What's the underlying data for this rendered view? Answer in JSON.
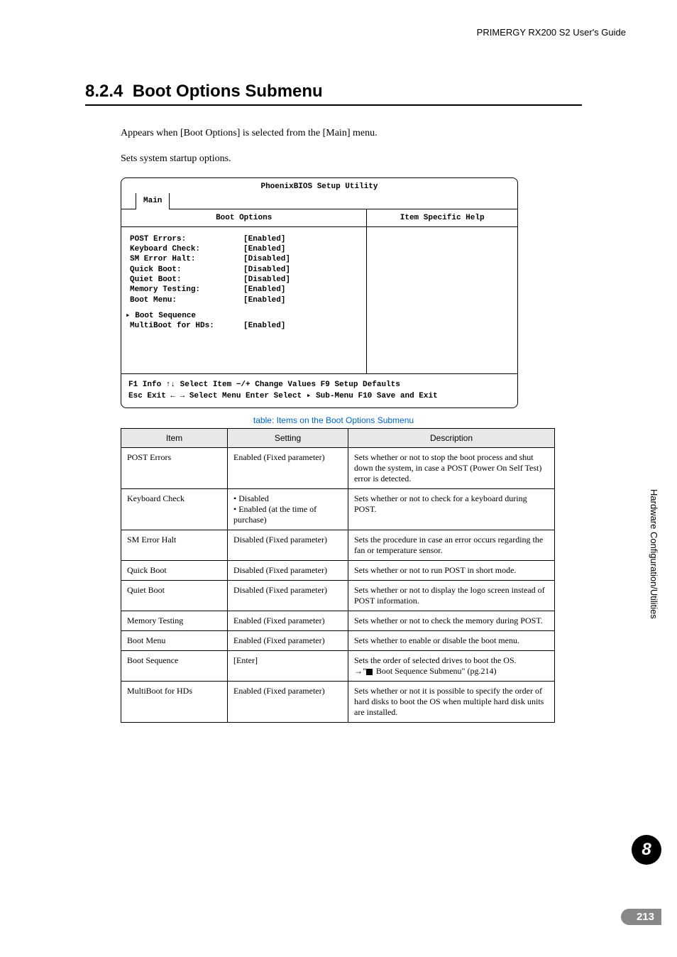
{
  "header": {
    "doc": "PRIMERGY RX200 S2 User's Guide"
  },
  "section": {
    "number": "8.2.4",
    "title": "Boot Options Submenu",
    "intro1": "Appears when [Boot Options] is selected from the [Main] menu.",
    "intro2": "Sets system startup options."
  },
  "bios": {
    "utility_title": "PhoenixBIOS Setup Utility",
    "tab": "Main",
    "left_header": "Boot Options",
    "right_header": "Item Specific Help",
    "rows": [
      {
        "label": "POST Errors:",
        "value": "[Enabled]"
      },
      {
        "label": "Keyboard Check:",
        "value": "[Enabled]"
      },
      {
        "label": "SM Error Halt:",
        "value": "[Disabled]"
      },
      {
        "label": "Quick Boot:",
        "value": "[Disabled]"
      },
      {
        "label": "Quiet Boot:",
        "value": "[Disabled]"
      },
      {
        "label": "Memory Testing:",
        "value": "[Enabled]"
      },
      {
        "label": "Boot Menu:",
        "value": "[Enabled]"
      }
    ],
    "sub_heading": "▸ Boot Sequence",
    "sub_row": {
      "label": "MultiBoot for HDs:",
      "value": "[Enabled]"
    },
    "footer1": "F1  Info   ↑↓  Select Item  −/+     Change Values     F9  Setup Defaults",
    "footer2": "Esc Exit  ← → Select Menu  Enter    Select ▸ Sub-Menu  F10 Save and Exit"
  },
  "table": {
    "caption": "table: Items on the Boot Options Submenu",
    "headers": {
      "c1": "Item",
      "c2": "Setting",
      "c3": "Description"
    },
    "rows": [
      {
        "item": "POST Errors",
        "setting": "Enabled (Fixed parameter)",
        "desc": "Sets whether or not to stop the boot process and shut down the system, in case a POST (Power On Self Test) error is detected."
      },
      {
        "item": "Keyboard Check",
        "setting": "• Disabled\n• Enabled (at the time of purchase)",
        "desc": "Sets whether or not to check for a keyboard during POST."
      },
      {
        "item": "SM Error Halt",
        "setting": "Disabled (Fixed parameter)",
        "desc": "Sets the procedure in case an error occurs regarding the fan or temperature sensor."
      },
      {
        "item": "Quick Boot",
        "setting": "Disabled (Fixed parameter)",
        "desc": "Sets whether or not to run POST in short mode."
      },
      {
        "item": "Quiet Boot",
        "setting": "Disabled (Fixed parameter)",
        "desc": "Sets whether or not to display the logo screen instead of POST information."
      },
      {
        "item": "Memory Testing",
        "setting": "Enabled (Fixed parameter)",
        "desc": "Sets whether or not to check the memory during POST."
      },
      {
        "item": "Boot Menu",
        "setting": "Enabled (Fixed parameter)",
        "desc": "Sets whether to enable or disable the boot menu."
      },
      {
        "item": "Boot Sequence",
        "setting": "[Enter]",
        "desc": "Sets the order of selected drives to boot the OS.\n→\"■ Boot Sequence Submenu\" (pg.214)"
      },
      {
        "item": "MultiBoot for HDs",
        "setting": "Enabled (Fixed parameter)",
        "desc": "Sets whether or not it is possible to specify the order of hard disks to boot the OS when multiple hard disk units are installed."
      }
    ]
  },
  "sidebar": {
    "text": "Hardware Configuration/Utilities"
  },
  "chapter_badge": "8",
  "page_number": "213"
}
